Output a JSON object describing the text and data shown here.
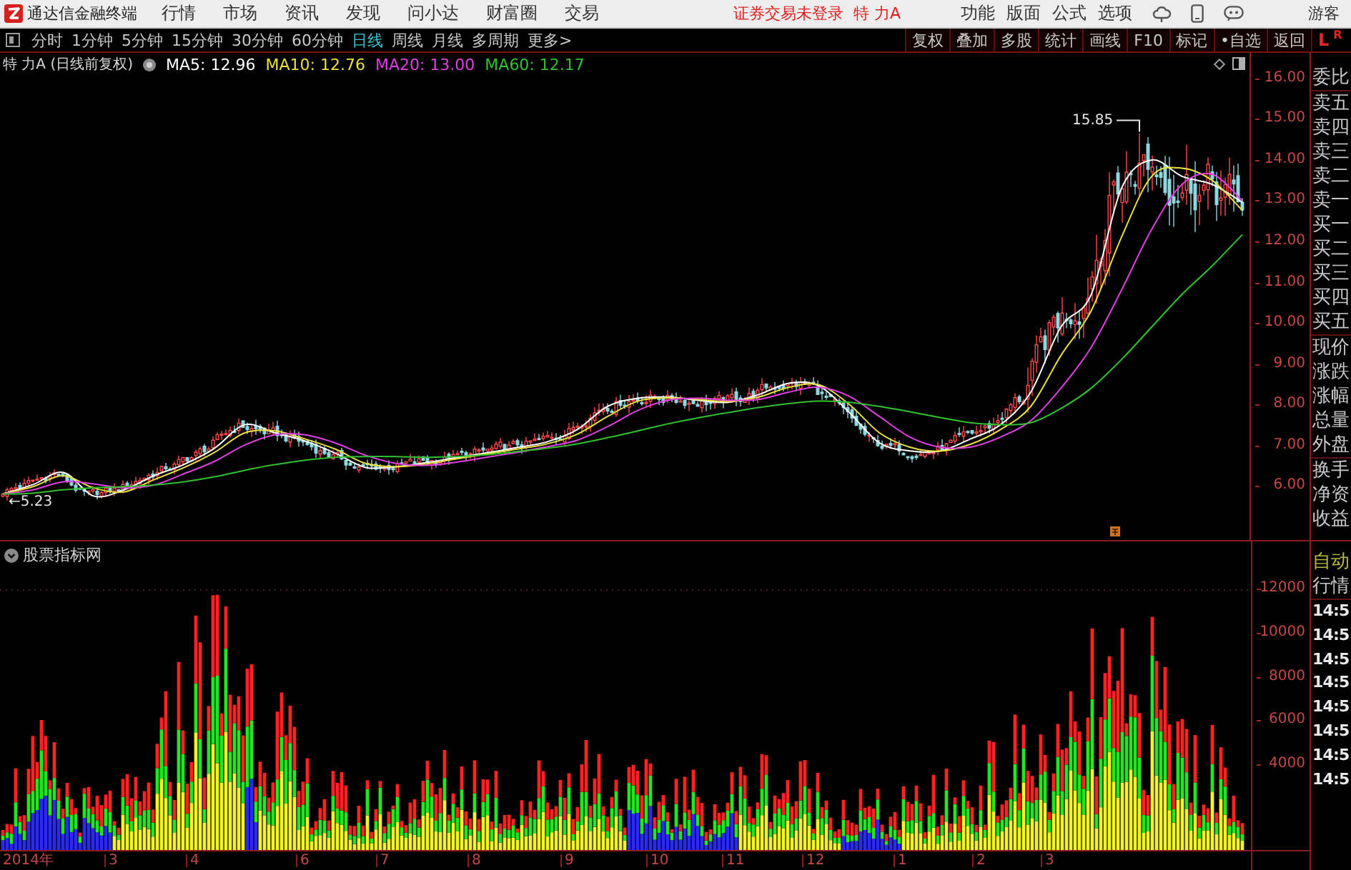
{
  "title_bar": {
    "app_name": "通达信金融终端",
    "menus": [
      "行情",
      "市场",
      "资讯",
      "发现",
      "问小达",
      "财富圈",
      "交易"
    ],
    "trade_status": "证券交易未登录",
    "stock_name": "特 力A",
    "tools": [
      "功能",
      "版面",
      "公式",
      "选项"
    ],
    "user": "游客"
  },
  "period_bar": {
    "periods": [
      {
        "label": "分时",
        "selected": false
      },
      {
        "label": "1分钟",
        "selected": false
      },
      {
        "label": "5分钟",
        "selected": false
      },
      {
        "label": "15分钟",
        "selected": false
      },
      {
        "label": "30分钟",
        "selected": false
      },
      {
        "label": "60分钟",
        "selected": false
      },
      {
        "label": "日线",
        "selected": true
      },
      {
        "label": "周线",
        "selected": false
      },
      {
        "label": "月线",
        "selected": false
      },
      {
        "label": "多周期",
        "selected": false
      },
      {
        "label": "更多>",
        "selected": false
      }
    ],
    "buttons": [
      "复权",
      "叠加",
      "多股",
      "统计",
      "画线",
      "F10",
      "标记",
      "•自选",
      "返回"
    ],
    "layout_toggles": [
      "L",
      "R"
    ]
  },
  "price_chart": {
    "title": "特 力A (日线前复权)",
    "high_label": "15.85",
    "low_label": "←5.23",
    "chart_data": {
      "type": "line",
      "categories": [
        null,
        null,
        null,
        null,
        null,
        null,
        null,
        null,
        null,
        null,
        null,
        null,
        null,
        null,
        null,
        null,
        null,
        null,
        null,
        null,
        null,
        null,
        null,
        null,
        null,
        null,
        null,
        null,
        null,
        null,
        null,
        null,
        null,
        null,
        null,
        null,
        null,
        null,
        null,
        null,
        null,
        null
      ],
      "series": [
        {
          "name": "MA5: 12.96",
          "color": "#ffffff",
          "values": [
            5.8,
            6.03,
            6.33,
            5.75,
            5.9,
            6.25,
            6.53,
            6.92,
            7.5,
            7.3,
            7.1,
            6.8,
            6.45,
            6.47,
            6.57,
            6.69,
            6.81,
            6.94,
            7.08,
            7.38,
            7.95,
            8.15,
            8.18,
            8.1,
            8.05,
            8.24,
            8.52,
            8.45,
            7.8,
            7.05,
            6.86,
            6.85,
            7.15,
            7.5,
            8.3,
            9.9,
            10.7,
            13.3,
            14.0,
            13.6,
            13.4,
            12.96
          ]
        },
        {
          "name": "MA10: 12.76",
          "color": "#e8e040",
          "values": [
            5.8,
            5.98,
            6.25,
            5.95,
            5.85,
            6.15,
            6.45,
            6.82,
            7.3,
            7.35,
            7.15,
            6.9,
            6.55,
            6.47,
            6.54,
            6.66,
            6.78,
            6.9,
            7.03,
            7.27,
            7.7,
            8.08,
            8.16,
            8.12,
            8.07,
            8.18,
            8.42,
            8.48,
            8.0,
            7.3,
            6.95,
            6.85,
            7.02,
            7.38,
            7.95,
            9.2,
            10.3,
            12.1,
            13.6,
            13.8,
            13.5,
            12.76
          ]
        },
        {
          "name": "MA20: 13.00",
          "color": "#e040e0",
          "values": [
            5.8,
            5.9,
            6.1,
            6.05,
            5.95,
            6.02,
            6.3,
            6.6,
            7.0,
            7.25,
            7.25,
            7.05,
            6.75,
            6.55,
            6.5,
            6.58,
            6.7,
            6.82,
            6.96,
            7.12,
            7.45,
            7.85,
            8.1,
            8.15,
            8.1,
            8.12,
            8.3,
            8.42,
            8.2,
            7.7,
            7.2,
            6.95,
            6.95,
            7.2,
            7.6,
            8.4,
            9.4,
            10.8,
            12.3,
            13.4,
            13.65,
            13.0
          ]
        },
        {
          "name": "MA60: 12.17",
          "color": "#30c030",
          "values": [
            5.8,
            5.82,
            5.9,
            5.95,
            5.98,
            6.02,
            6.1,
            6.22,
            6.38,
            6.52,
            6.63,
            6.7,
            6.72,
            6.72,
            6.7,
            6.72,
            6.76,
            6.84,
            6.92,
            7.03,
            7.18,
            7.35,
            7.52,
            7.67,
            7.8,
            7.92,
            8.02,
            8.08,
            8.05,
            7.95,
            7.82,
            7.68,
            7.55,
            7.5,
            7.55,
            7.9,
            8.4,
            9.1,
            9.9,
            10.7,
            11.4,
            12.17
          ]
        }
      ],
      "ylim": [
        4.67,
        16.63
      ],
      "yticks": [
        {
          "value": 16,
          "label": "16.00"
        },
        {
          "value": 15,
          "label": "15.00"
        },
        {
          "value": 14,
          "label": "14.00"
        },
        {
          "value": 13,
          "label": "13.00"
        },
        {
          "value": 12,
          "label": "12.00"
        },
        {
          "value": 11,
          "label": "11.00"
        },
        {
          "value": 10,
          "label": "10.00"
        },
        {
          "value": 9,
          "label": "9.00"
        },
        {
          "value": 8,
          "label": "8.00"
        },
        {
          "value": 7,
          "label": "7.00"
        },
        {
          "value": 6,
          "label": "6.00"
        }
      ]
    }
  },
  "indicator_panel": {
    "title": "股票指标网",
    "axis_labels": [
      "12000",
      "10000",
      "8000",
      "6000",
      "4000"
    ]
  },
  "date_axis": [
    "2014年",
    "3",
    "4",
    "6",
    "7",
    "8",
    "9",
    "10",
    "11",
    "12",
    "1",
    "2",
    "3"
  ],
  "quote_panel": {
    "sections": [
      [
        "委比"
      ],
      [
        "卖五",
        "卖四",
        "卖三",
        "卖二",
        "卖一",
        "买一",
        "买二",
        "买三",
        "买四",
        "买五"
      ],
      [
        "现价",
        "涨跌",
        "涨幅",
        "总量",
        "外盘"
      ],
      [
        "换手",
        "净资",
        "收益"
      ]
    ],
    "mode": "自动",
    "market": "行情",
    "times": [
      "14:5",
      "14:5",
      "14:5",
      "14:5",
      "14:5",
      "14:5",
      "14:5",
      "14:5"
    ]
  }
}
